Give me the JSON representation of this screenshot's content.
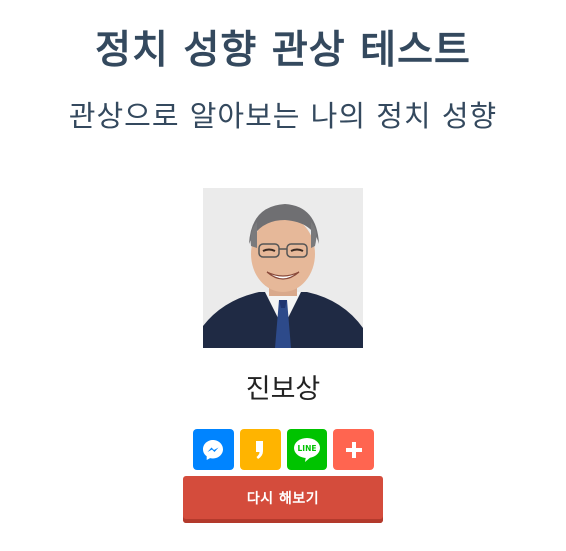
{
  "header": {
    "title": "정치 성향 관상 테스트",
    "subtitle": "관상으로 알아보는 나의 정치 성향"
  },
  "result": {
    "label": "진보상"
  },
  "share": {
    "buttons": [
      {
        "icon": "messenger-icon",
        "color": "#0084ff"
      },
      {
        "icon": "kakaostory-icon",
        "color": "#ffb400"
      },
      {
        "icon": "line-icon",
        "color": "#00c300",
        "text": "LINE"
      },
      {
        "icon": "plus-icon",
        "color": "#ff6550"
      }
    ]
  },
  "actions": {
    "retry_label": "다시 해보기"
  }
}
